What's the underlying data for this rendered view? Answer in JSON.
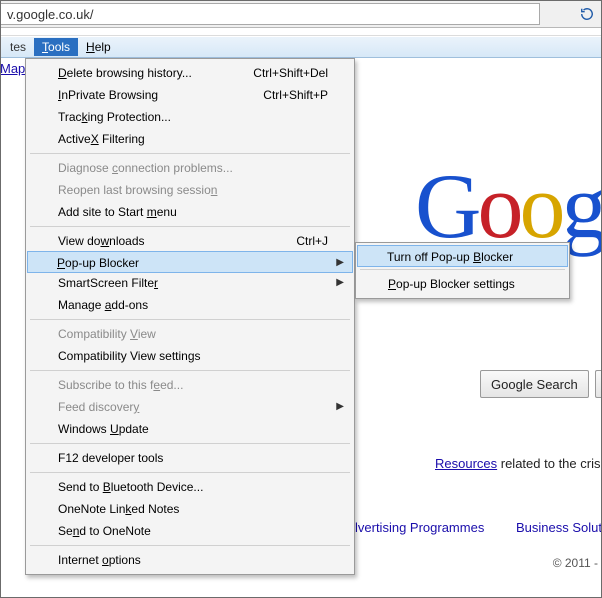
{
  "address_bar": {
    "url": "v.google.co.uk/"
  },
  "menubar": {
    "left_truncated": "tes",
    "tools": "Tools",
    "help": "Help"
  },
  "sidebar": {
    "maps_link": "Map"
  },
  "tools_menu": {
    "delete_history": "elete browsing history...",
    "delete_history_key": "D",
    "delete_history_shortcut": "Ctrl+Shift+Del",
    "inprivate": "nPrivate Browsing",
    "inprivate_key": "I",
    "inprivate_shortcut": "Ctrl+Shift+P",
    "tracking": "Trac",
    "tracking_key": "k",
    "tracking_after": "ing Protection...",
    "activex": "Active",
    "activex_key": "X",
    "activex_after": " Filtering",
    "diagnose": "Diagnose ",
    "diagnose_key": "c",
    "diagnose_after": "onnection problems...",
    "reopen": "Reopen last browsing sessio",
    "reopen_key": "n",
    "addsite": "Add site to Start ",
    "addsite_key": "m",
    "addsite_after": "enu",
    "downloads": "View do",
    "downloads_key": "w",
    "downloads_after": "nloads",
    "downloads_shortcut": "Ctrl+J",
    "popup": "op-up Blocker",
    "popup_key": "P",
    "smartscreen": "SmartScreen Filte",
    "smartscreen_key": "r",
    "addons": "Manage ",
    "addons_key": "a",
    "addons_after": "dd-ons",
    "compat_view": "Compatibility ",
    "compat_view_key": "V",
    "compat_view_after": "iew",
    "compat_settings": "Compatibility View settings",
    "subscribe": "Subscribe to this f",
    "subscribe_key": "e",
    "subscribe_after": "ed...",
    "feed_disc": "Feed discover",
    "feed_disc_key": "y",
    "win_update": "Windows ",
    "win_update_key": "U",
    "win_update_after": "pdate",
    "f12": "F12 developer tools",
    "bluetooth": "Send to ",
    "bluetooth_key": "B",
    "bluetooth_after": "luetooth Device...",
    "onenote_linked": "OneNote Lin",
    "onenote_linked_key": "k",
    "onenote_linked_after": "ed Notes",
    "onenote_send": "Se",
    "onenote_send_key": "n",
    "onenote_send_after": "d to OneNote",
    "internet_options": "Internet ",
    "internet_options_key": "o",
    "internet_options_after": "ptions"
  },
  "popup_submenu": {
    "turn_off_pre": "Turn off Pop-up ",
    "turn_off_key": "B",
    "turn_off_after": "locker",
    "settings_key": "P",
    "settings_after": "op-up Blocker settings"
  },
  "page": {
    "logo_g1": "G",
    "logo_o1": "o",
    "logo_o2": "o",
    "logo_g2": "g",
    "search_button": "Google Search",
    "resources_link": "Resources",
    "resources_text": " related to the cris",
    "adv_prog": "lvertising Programmes",
    "biz_sol": "Business Soluti",
    "copyright": "© 2011 -"
  }
}
